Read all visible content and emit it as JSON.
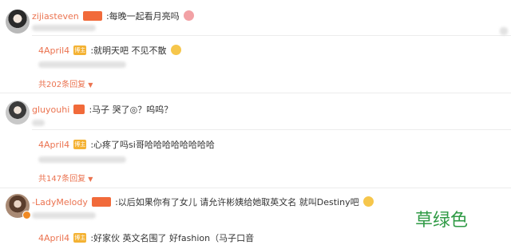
{
  "comments": [
    {
      "username": "zijiasteven",
      "text": ":每晚一起看月亮吗",
      "reply": {
        "username": "4April4",
        "text": ":就明天吧 不见不散"
      },
      "more": "共202条回复"
    },
    {
      "username": "gluyouhi",
      "text": ":马子 哭了◎？呜呜？",
      "reply": {
        "username": "4April4",
        "text": ":心疼了吗si哥哈哈哈哈哈哈哈哈"
      },
      "more": "共147条回复"
    },
    {
      "username": "-LadyMelody",
      "text": ":以后如果你有了女儿 请允许彬姨给她取英文名 就叫Destiny吧",
      "reply": {
        "username": "4April4",
        "text": ":好家伙 英文名围了 好fashion（马子口音"
      },
      "more": ""
    }
  ],
  "badges": {
    "reply_badge": "博主"
  },
  "overlay_label": "草绿色",
  "colors": {
    "accent": "#eb7350",
    "label_green": "#2f9a45"
  },
  "icons": [
    "emoji-smile-icon",
    "emoji-shy-icon",
    "chevron-down-icon",
    "verified-badge-icon"
  ]
}
